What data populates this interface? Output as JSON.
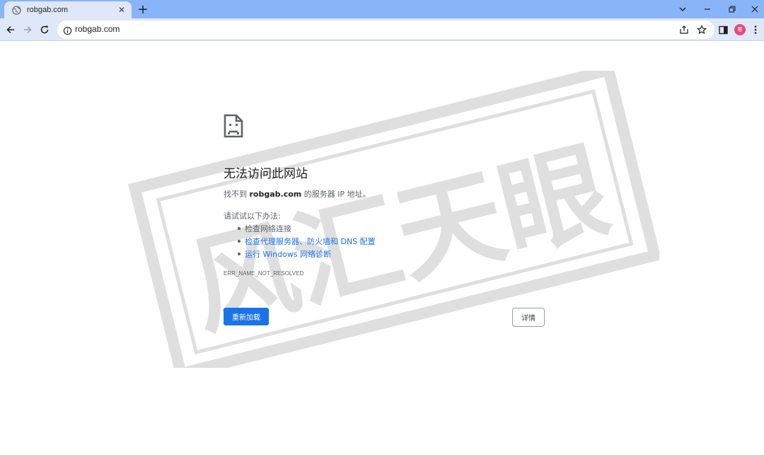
{
  "tab": {
    "title": "robgab.com",
    "close": "✕"
  },
  "newtab": "+",
  "omnibox": {
    "url": "robgab.com"
  },
  "profile": {
    "initial": "寒"
  },
  "error": {
    "title": "无法访问此网站",
    "sub_prefix": "找不到 ",
    "sub_host": "robgab.com",
    "sub_suffix": " 的服务器 IP 地址。",
    "try_label": "请试试以下办法:",
    "suggestions": [
      {
        "label": "检查网络连接",
        "link": false
      },
      {
        "label": "检查代理服务器、防火墙和 DNS 配置",
        "link": true
      },
      {
        "label": "运行 Windows 网络诊断",
        "link": true
      }
    ],
    "code": "ERR_NAME_NOT_RESOLVED"
  },
  "buttons": {
    "reload": "重新加载",
    "details": "详情"
  },
  "watermark": {
    "text": "风汇天眼"
  },
  "colors": {
    "accent": "#1a73e8",
    "tabbar": "#8ab4f8",
    "toolbar": "#dfe8f8"
  }
}
